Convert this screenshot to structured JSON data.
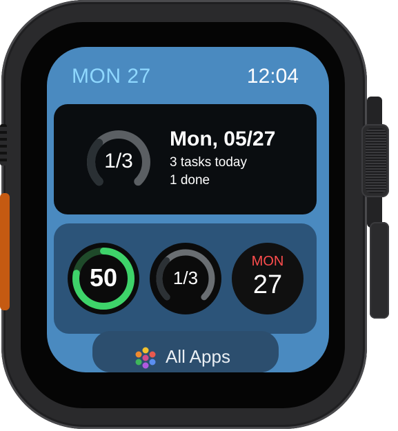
{
  "status": {
    "date": "MON 27",
    "time": "12:04"
  },
  "widget": {
    "progress_label": "1/3",
    "progress_fraction": 0.33,
    "title": "Mon, 05/27",
    "line1": "3 tasks today",
    "line2": "1 done"
  },
  "complications": {
    "activity": {
      "value": "50",
      "fill_fraction": 0.78
    },
    "tasks": {
      "value": "1/3",
      "fill_fraction": 0.33
    },
    "calendar": {
      "day": "MON",
      "date": "27"
    }
  },
  "dock": {
    "label": "All Apps"
  },
  "colors": {
    "accent_date": "#8fd8ff",
    "screen_bg": "#4a8ac0",
    "activity_green": "#3ed36a",
    "calendar_red": "#ff4d4d"
  },
  "icons": {
    "apps": "dots-grid-icon",
    "activity": "progress-ring-icon",
    "tasks": "progress-ring-icon"
  }
}
